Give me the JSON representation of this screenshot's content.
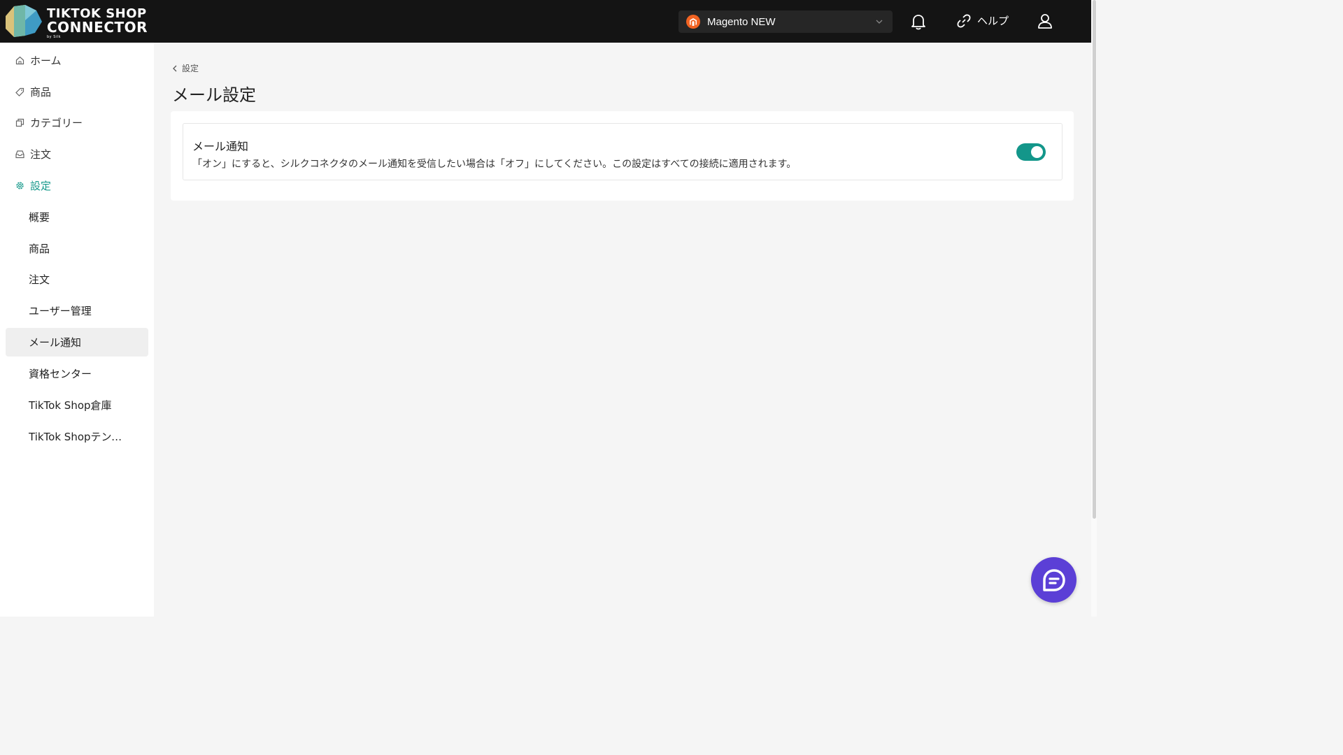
{
  "brand": {
    "line1": "TIKTOK SHOP",
    "line2": "CONNECTOR",
    "by": "by Silk"
  },
  "header": {
    "store_name": "Magento NEW",
    "help_label": "ヘルプ"
  },
  "sidebar": {
    "items": [
      {
        "label": "ホーム",
        "icon": "home-icon"
      },
      {
        "label": "商品",
        "icon": "tag-icon"
      },
      {
        "label": "カテゴリー",
        "icon": "copy-icon"
      },
      {
        "label": "注文",
        "icon": "inbox-icon"
      },
      {
        "label": "設定",
        "icon": "gear-icon"
      }
    ],
    "sub_items": [
      {
        "label": "概要"
      },
      {
        "label": "商品"
      },
      {
        "label": "注文"
      },
      {
        "label": "ユーザー管理"
      },
      {
        "label": "メール通知"
      },
      {
        "label": "資格センター"
      },
      {
        "label": "TikTok Shop倉庫"
      },
      {
        "label": "TikTok Shopテンプレ..."
      }
    ]
  },
  "main": {
    "breadcrumb": "設定",
    "title": "メール設定",
    "setting": {
      "title": "メール通知",
      "description": "「オン」にすると、シルクコネクタのメール通知を受信したい場合は「オフ」にしてください。この設定はすべての接続に適用されます。",
      "enabled": true
    }
  },
  "colors": {
    "accent": "#14988a",
    "topbar": "#141414",
    "chat": "#5b3fd6"
  }
}
